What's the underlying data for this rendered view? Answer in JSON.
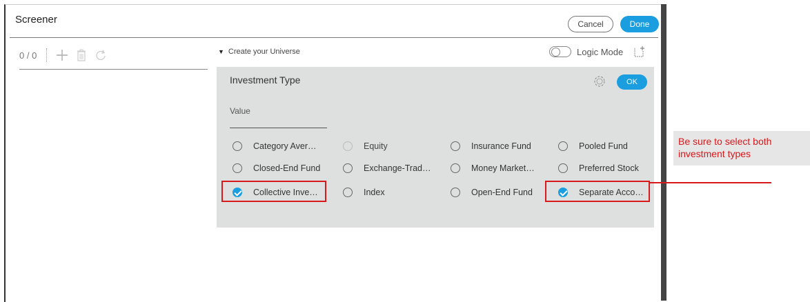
{
  "window": {
    "title": "Screener",
    "cancel_label": "Cancel",
    "done_label": "Done"
  },
  "toolbar": {
    "count": "0 / 0"
  },
  "universe": {
    "label": "Create your Universe",
    "logic_mode_label": "Logic Mode"
  },
  "panel": {
    "title": "Investment Type",
    "ok_label": "OK",
    "value_label": "Value",
    "options": [
      {
        "label": "Category Aver…",
        "state": "unchecked"
      },
      {
        "label": "Closed-End Fund",
        "state": "unchecked"
      },
      {
        "label": "Collective Inve…",
        "state": "checked"
      },
      {
        "label": "Equity",
        "state": "disabled"
      },
      {
        "label": "Exchange-Trad…",
        "state": "unchecked"
      },
      {
        "label": "Index",
        "state": "unchecked"
      },
      {
        "label": "Insurance Fund",
        "state": "unchecked"
      },
      {
        "label": "Money Market…",
        "state": "unchecked"
      },
      {
        "label": "Open-End Fund",
        "state": "unchecked"
      },
      {
        "label": "Pooled Fund",
        "state": "unchecked"
      },
      {
        "label": "Preferred Stock",
        "state": "unchecked"
      },
      {
        "label": "Separate Acco…",
        "state": "checked"
      }
    ]
  },
  "callout": {
    "text": "Be sure to select both investment types",
    "color": "#d7191c"
  },
  "colors": {
    "accent": "#1a9ee0",
    "panel_bg": "#dde0df",
    "highlight": "#d7191c"
  }
}
